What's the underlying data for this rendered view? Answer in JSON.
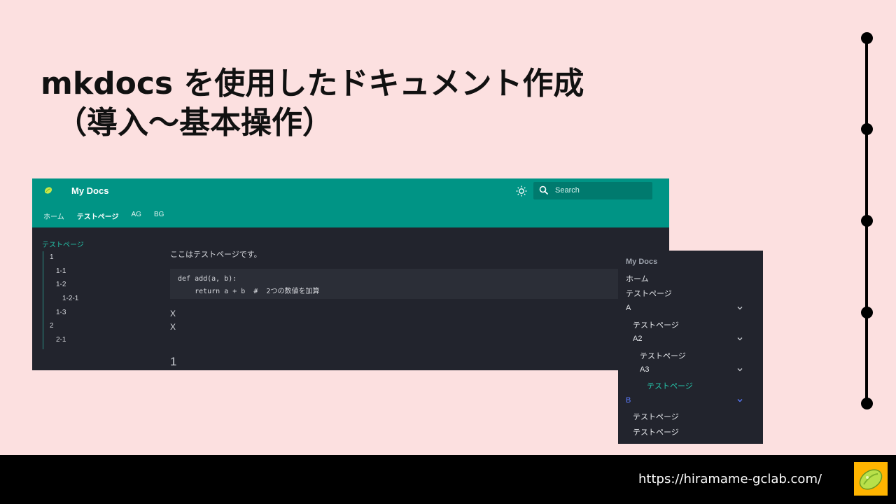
{
  "slide": {
    "title_line1": "mkdocs を使用したドキュメント作成",
    "title_line2": "（導入～基本操作）"
  },
  "docs": {
    "site_name": "My Docs",
    "search_placeholder": "Search",
    "tabs": [
      "ホーム",
      "テストページ",
      "AG",
      "BG"
    ],
    "active_tab": "テストページ",
    "sidebar": {
      "title": "テストページ",
      "items": [
        "1",
        "1-1",
        "1-2",
        "1-2-1",
        "1-3",
        "2",
        "2-1"
      ]
    },
    "content": {
      "paragraph": "ここはテストページです。",
      "code_line1": "def add(a, b):",
      "code_line2": "    return a + b  #  2つの数値を加算",
      "x1": "X",
      "x2": "X",
      "heading": "1"
    }
  },
  "nav_panel": {
    "title": "My Docs",
    "items": [
      "ホーム",
      "テストページ",
      "A",
      "テストページ",
      "A2",
      "テストページ",
      "A3",
      "テストページ",
      "B",
      "テストページ",
      "テストページ"
    ]
  },
  "footer": {
    "url": "https://hiramame-gclab.com/"
  },
  "colors": {
    "slide_bg": "#fce0e0",
    "header_teal": "#009485",
    "docs_bg": "#22242d",
    "accent_teal": "#25c2a8",
    "accent_blue": "#5b7cff",
    "logo_yellow": "#ffb400",
    "logo_green": "#b8e04a"
  },
  "icons": [
    "bean-logo-icon",
    "sun-icon",
    "search-icon",
    "chevron-down-icon"
  ]
}
